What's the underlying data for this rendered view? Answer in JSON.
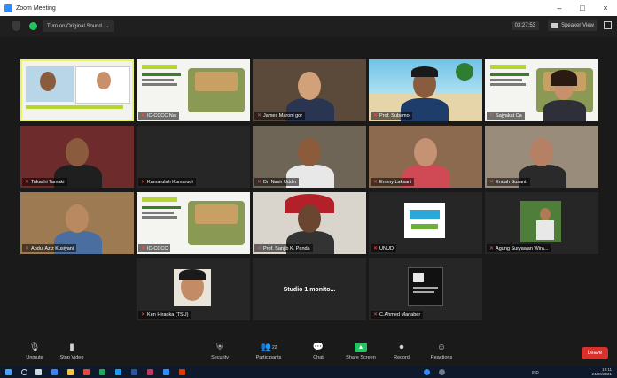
{
  "window": {
    "title": "Zoom Meeting",
    "controls": [
      "–",
      "□",
      "×"
    ]
  },
  "topbar": {
    "audio_option": "Turn on Original Sound",
    "timer": "03:27:53",
    "view_label": "Speaker View"
  },
  "participants": [
    {
      "name": "",
      "type": "screen",
      "active": true
    },
    {
      "name": "IC-CCCC Nat",
      "type": "slide"
    },
    {
      "name": "James Maroni gor",
      "type": "person",
      "bg": "#5b4a3a",
      "skin": "#d2a079",
      "shirt": "#2a3552"
    },
    {
      "name": "Prof. Subamo",
      "type": "beach"
    },
    {
      "name": "Sajyakat Ca",
      "type": "slide-person",
      "skin": "#c8906b",
      "shirt": "#2f2f3a"
    },
    {
      "name": "Takashi Tamaki",
      "type": "person",
      "bg": "#6d2b2b",
      "skin": "#8a5b3d",
      "shirt": "#1f1f1f"
    },
    {
      "name": "Kamarulah Kamarudi",
      "type": "blank"
    },
    {
      "name": "Dr. Nasir Uddin",
      "type": "person",
      "bg": "#6f6556",
      "skin": "#8b5b3c",
      "shirt": "#e8e8e8"
    },
    {
      "name": "Ernmy Laksani",
      "type": "person",
      "bg": "#8b6a4f",
      "skin": "#c59273",
      "shirt": "#d04a55"
    },
    {
      "name": "Endah Susanti",
      "type": "person",
      "bg": "#9a8c7a",
      "skin": "#b68064",
      "shirt": "#2a2a2a"
    },
    {
      "name": "Abdul Aziz Kusiyani",
      "type": "person",
      "bg": "#9e7a52",
      "skin": "#b98a62",
      "shirt": "#4a6ea0"
    },
    {
      "name": "IC-CCCC",
      "type": "slide"
    },
    {
      "name": "Prof. Sanjib K. Panda",
      "type": "umbrella",
      "skin": "#6a4530",
      "shirt": "#333"
    },
    {
      "name": "UNUD",
      "type": "logo"
    },
    {
      "name": "Agung Suryawan Wira...",
      "type": "plant"
    },
    {
      "name": "Ken Hiraoka (TSU)",
      "type": "portrait",
      "skin": "#c48c66"
    },
    {
      "name": "",
      "type": "studio",
      "caption": "Studio 1 monito..."
    },
    {
      "name": "C.Ahmed Marjaber",
      "type": "uhs"
    }
  ],
  "toolbar": {
    "items": [
      {
        "label": "Unmute",
        "icon": "microphone-icon",
        "glyph": "🎙"
      },
      {
        "label": "Stop Video",
        "icon": "video-camera-icon",
        "glyph": "▮"
      },
      {
        "label": "Security",
        "icon": "shield-icon",
        "glyph": "⛨"
      },
      {
        "label": "Participants",
        "icon": "participants-icon",
        "glyph": "👥"
      },
      {
        "label": "Chat",
        "icon": "chat-icon",
        "glyph": "💬"
      },
      {
        "label": "Share Screen",
        "icon": "share-screen-icon",
        "glyph": "▲"
      },
      {
        "label": "Record",
        "icon": "record-icon",
        "glyph": "⏺"
      },
      {
        "label": "Reactions",
        "icon": "reactions-icon",
        "glyph": "☺"
      }
    ],
    "participant_count": "22",
    "leave": "Leave"
  },
  "taskbar": {
    "time": "13:11",
    "date": "24/06/2021",
    "lang": "IND"
  },
  "colors": {
    "accent": "#2d8cff",
    "active_outline": "#e8f26a",
    "leave": "#d9312b",
    "share_green": "#22c55e"
  }
}
